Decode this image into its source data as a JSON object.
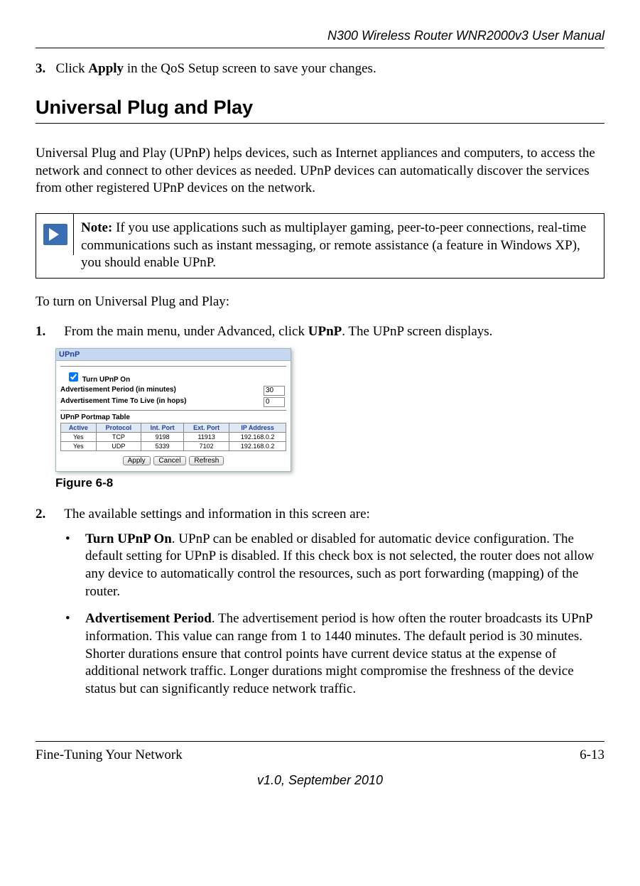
{
  "header": {
    "title": "N300 Wireless Router WNR2000v3 User Manual"
  },
  "step3": {
    "num": "3.",
    "before": "Click ",
    "bold": "Apply",
    "after": " in the QoS Setup screen to save your changes."
  },
  "section_heading": "Universal Plug and Play",
  "intro": "Universal Plug and Play (UPnP) helps devices, such as Internet appliances and computers, to access the network and connect to other devices as needed. UPnP devices can automatically discover the services from other registered UPnP devices on the network.",
  "note": {
    "label": "Note:",
    "text": " If you use applications such as multiplayer gaming, peer-to-peer connections, real-time communications such as instant messaging, or remote assistance (a feature in Windows XP), you should enable UPnP."
  },
  "lead_in": "To turn on Universal Plug and Play:",
  "step1": {
    "num": "1.",
    "before": "From the main menu, under Advanced, click ",
    "bold": "UPnP",
    "after": ". The UPnP screen displays."
  },
  "upnp": {
    "title": "UPnP",
    "checkbox_label": "Turn UPnP On",
    "adv_period_label": "Advertisement Period (in minutes)",
    "adv_period_value": "30",
    "ttl_label": "Advertisement Time To Live (in hops)",
    "ttl_value": "0",
    "portmap_heading": "UPnP Portmap Table",
    "headers": [
      "Active",
      "Protocol",
      "Int. Port",
      "Ext. Port",
      "IP Address"
    ],
    "rows": [
      [
        "Yes",
        "TCP",
        "9198",
        "11913",
        "192.168.0.2"
      ],
      [
        "Yes",
        "UDP",
        "5339",
        "7102",
        "192.168.0.2"
      ]
    ],
    "buttons": {
      "apply": "Apply",
      "cancel": "Cancel",
      "refresh": "Refresh"
    }
  },
  "figure_caption": "Figure 6-8",
  "step2": {
    "num": "2.",
    "text": "The available settings and information in this screen are:"
  },
  "bullets": [
    {
      "bold": "Turn UPnP On",
      "text": ". UPnP can be enabled or disabled for automatic device configuration. The default setting for UPnP is disabled. If this check box is not selected, the router does not allow any device to automatically control the resources, such as port forwarding (mapping) of the router."
    },
    {
      "bold": "Advertisement Period",
      "text": ". The advertisement period is how often the router broadcasts its UPnP information. This value can range from 1 to 1440 minutes. The default period is 30 minutes. Shorter durations ensure that control points have current device status at the expense of additional network traffic. Longer durations might compromise the freshness of the device status but can significantly reduce network traffic."
    }
  ],
  "footer": {
    "section": "Fine-Tuning Your Network",
    "page": "6-13",
    "version": "v1.0, September 2010"
  }
}
